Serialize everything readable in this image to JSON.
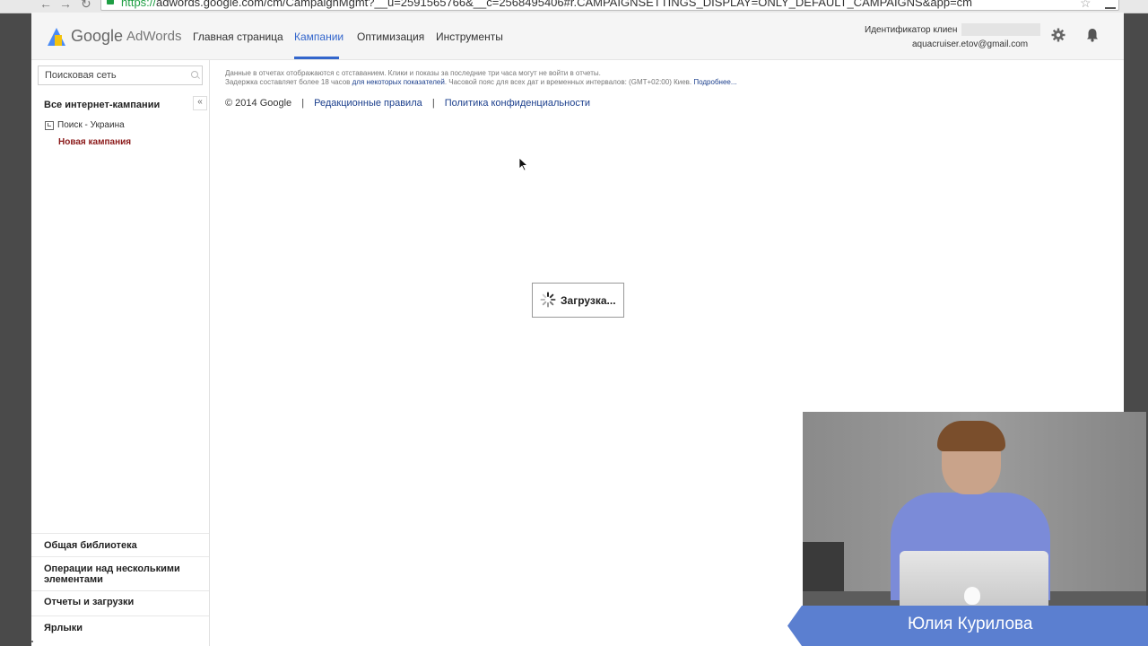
{
  "browser": {
    "url_scheme": "https://",
    "url_rest": "adwords.google.com/cm/CampaignMgmt?__u=2591565766&__c=2568495406#r.CAMPAIGNSETTINGS_DISPLAY=ONLY_DEFAULT_CAMPAIGNS&app=cm"
  },
  "header": {
    "logo_google": "Google",
    "logo_adwords": "AdWords",
    "nav": [
      {
        "label": "Главная страница",
        "active": false
      },
      {
        "label": "Кампании",
        "active": true
      },
      {
        "label": "Оптимизация",
        "active": false
      },
      {
        "label": "Инструменты",
        "active": false
      }
    ],
    "client_id_label": "Идентификатор клиен",
    "account_email": "aquacruiser.etov@gmail.com"
  },
  "sidebar": {
    "search_placeholder": "Поисковая сеть",
    "all_campaigns": "Все интернет-кампании",
    "campaign_search_ua": "Поиск - Украина",
    "new_campaign": "Новая кампания",
    "bottom_items": [
      "Общая библиотека",
      "Операции над несколькими элементами",
      "Отчеты и загрузки",
      "Ярлыки"
    ]
  },
  "main": {
    "notice_line1": "Данные в отчетах отображаются с отставанием. Клики и показы за последние три часа могут не войти в отчеты.",
    "notice_line2_a": "Задержка составляет более 18 часов ",
    "notice_line2_link": "для некоторых показателей",
    "notice_line2_b": ". Часовой пояс для всех дат и временных интервалов: (GMT+02:00) Киев. ",
    "notice_more": "Подробнее...",
    "footer_copyright": "© 2014 Google",
    "footer_link_editorial": "Редакционные правила",
    "footer_link_privacy": "Политика конфиденциальности",
    "loading_text": "Загрузка..."
  },
  "overlay": {
    "speaker_name": "Юлия Курилова"
  },
  "colors": {
    "accent": "#3366cc",
    "campaign_red": "#8b1a1a",
    "link": "#1a3e8c",
    "speaker_band": "#5b7fd0"
  }
}
